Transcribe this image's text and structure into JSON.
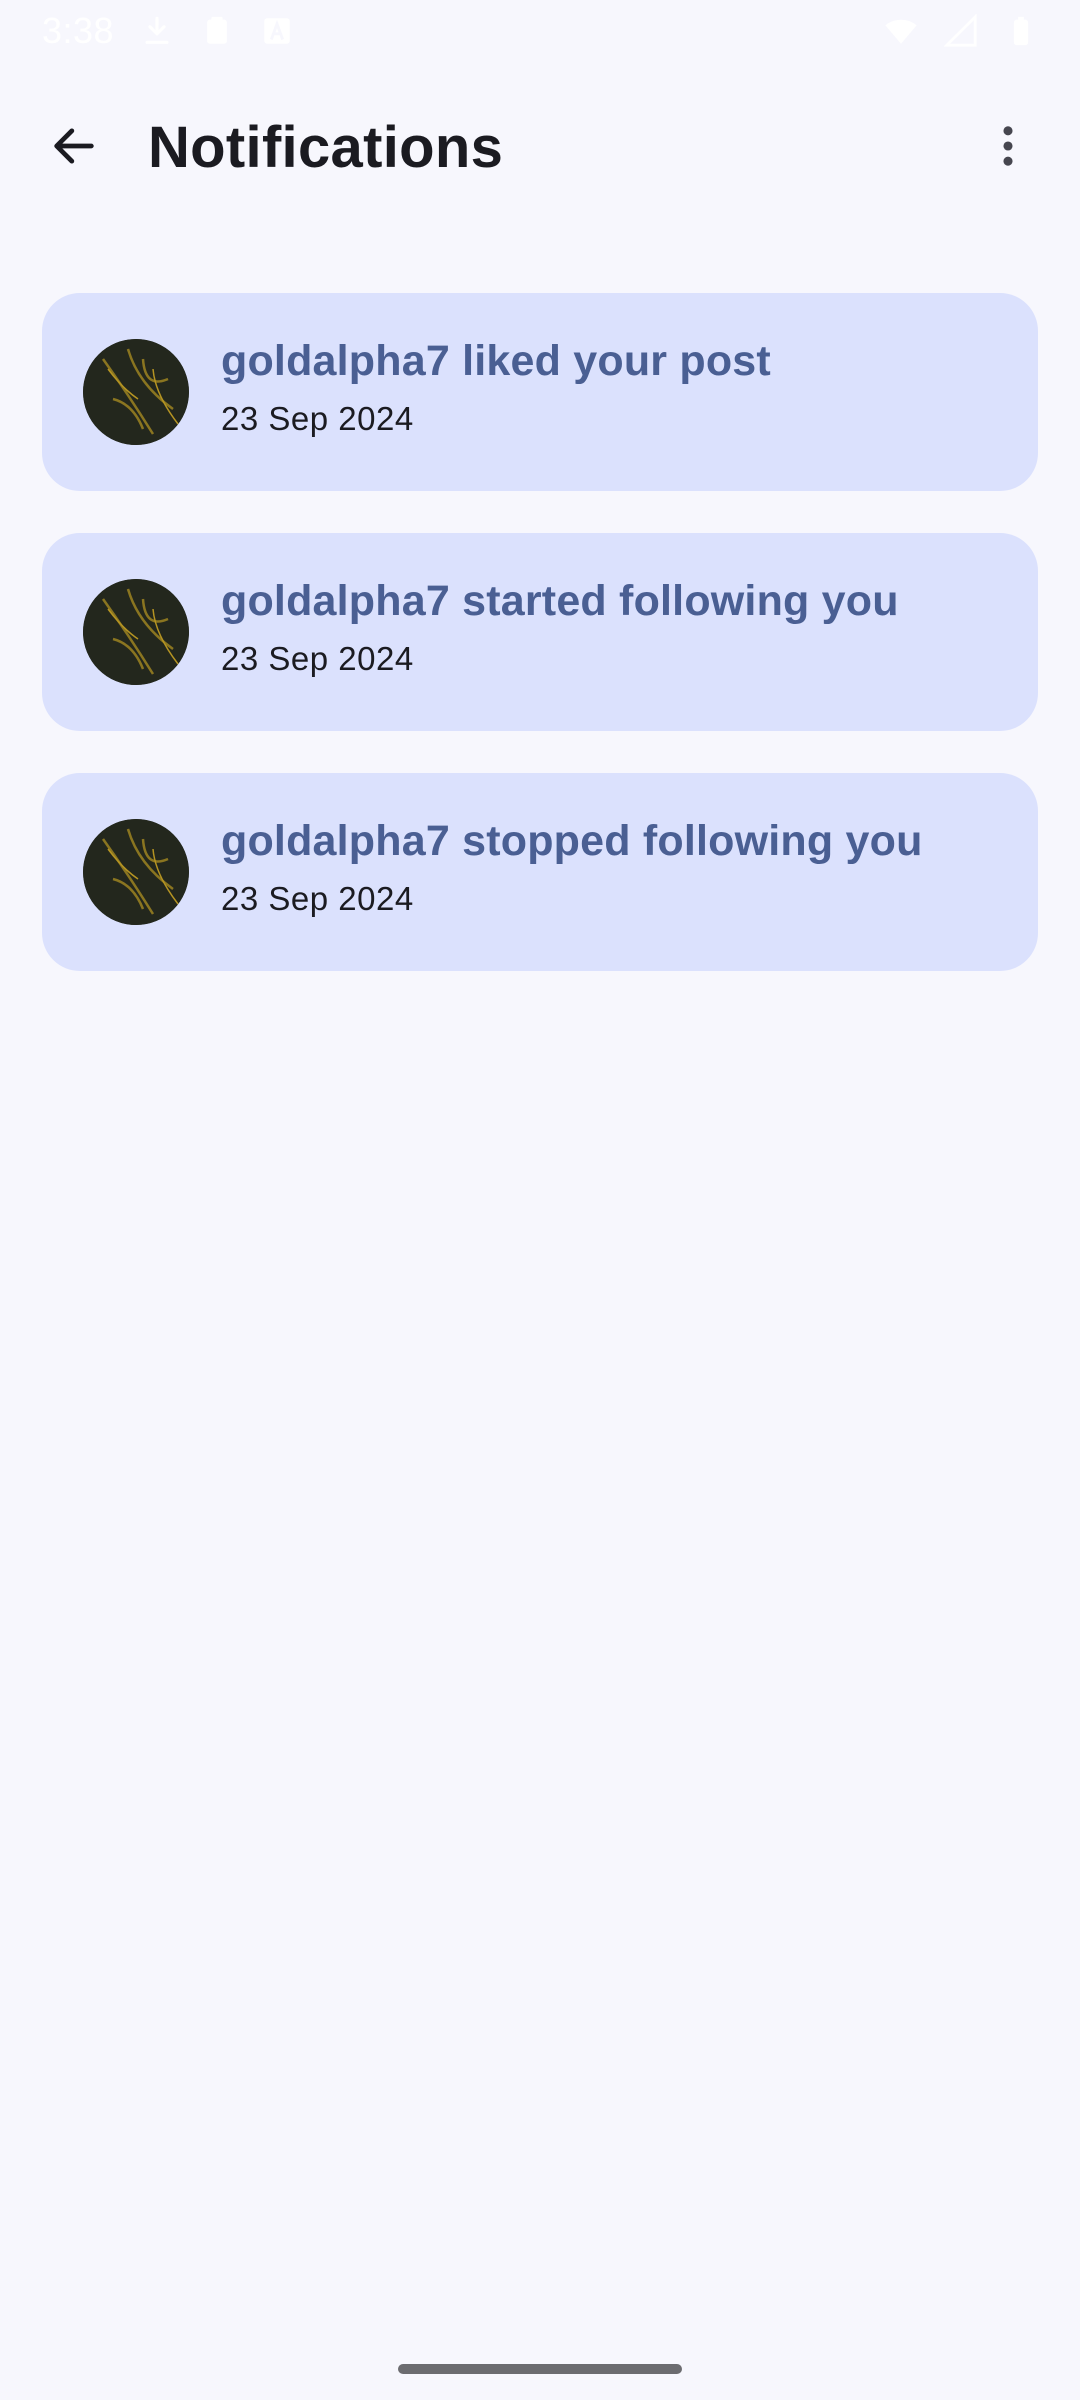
{
  "status_bar": {
    "time": "3:38",
    "icons": [
      "download-icon",
      "clipboard-icon",
      "font-icon",
      "wifi-icon",
      "signal-icon",
      "battery-icon"
    ]
  },
  "app_bar": {
    "title": "Notifications",
    "back_icon": "arrow-back-icon",
    "more_icon": "more-vert-icon"
  },
  "notifications": [
    {
      "text": "goldalpha7 liked your post",
      "date": "23 Sep 2024"
    },
    {
      "text": "goldalpha7 started following you",
      "date": "23 Sep 2024"
    },
    {
      "text": "goldalpha7 stopped following you",
      "date": "23 Sep 2024"
    }
  ],
  "colors": {
    "background": "#f7f7fd",
    "card": "#dbe1fd",
    "card_title": "#4a5f93",
    "text": "#1b1b21"
  }
}
